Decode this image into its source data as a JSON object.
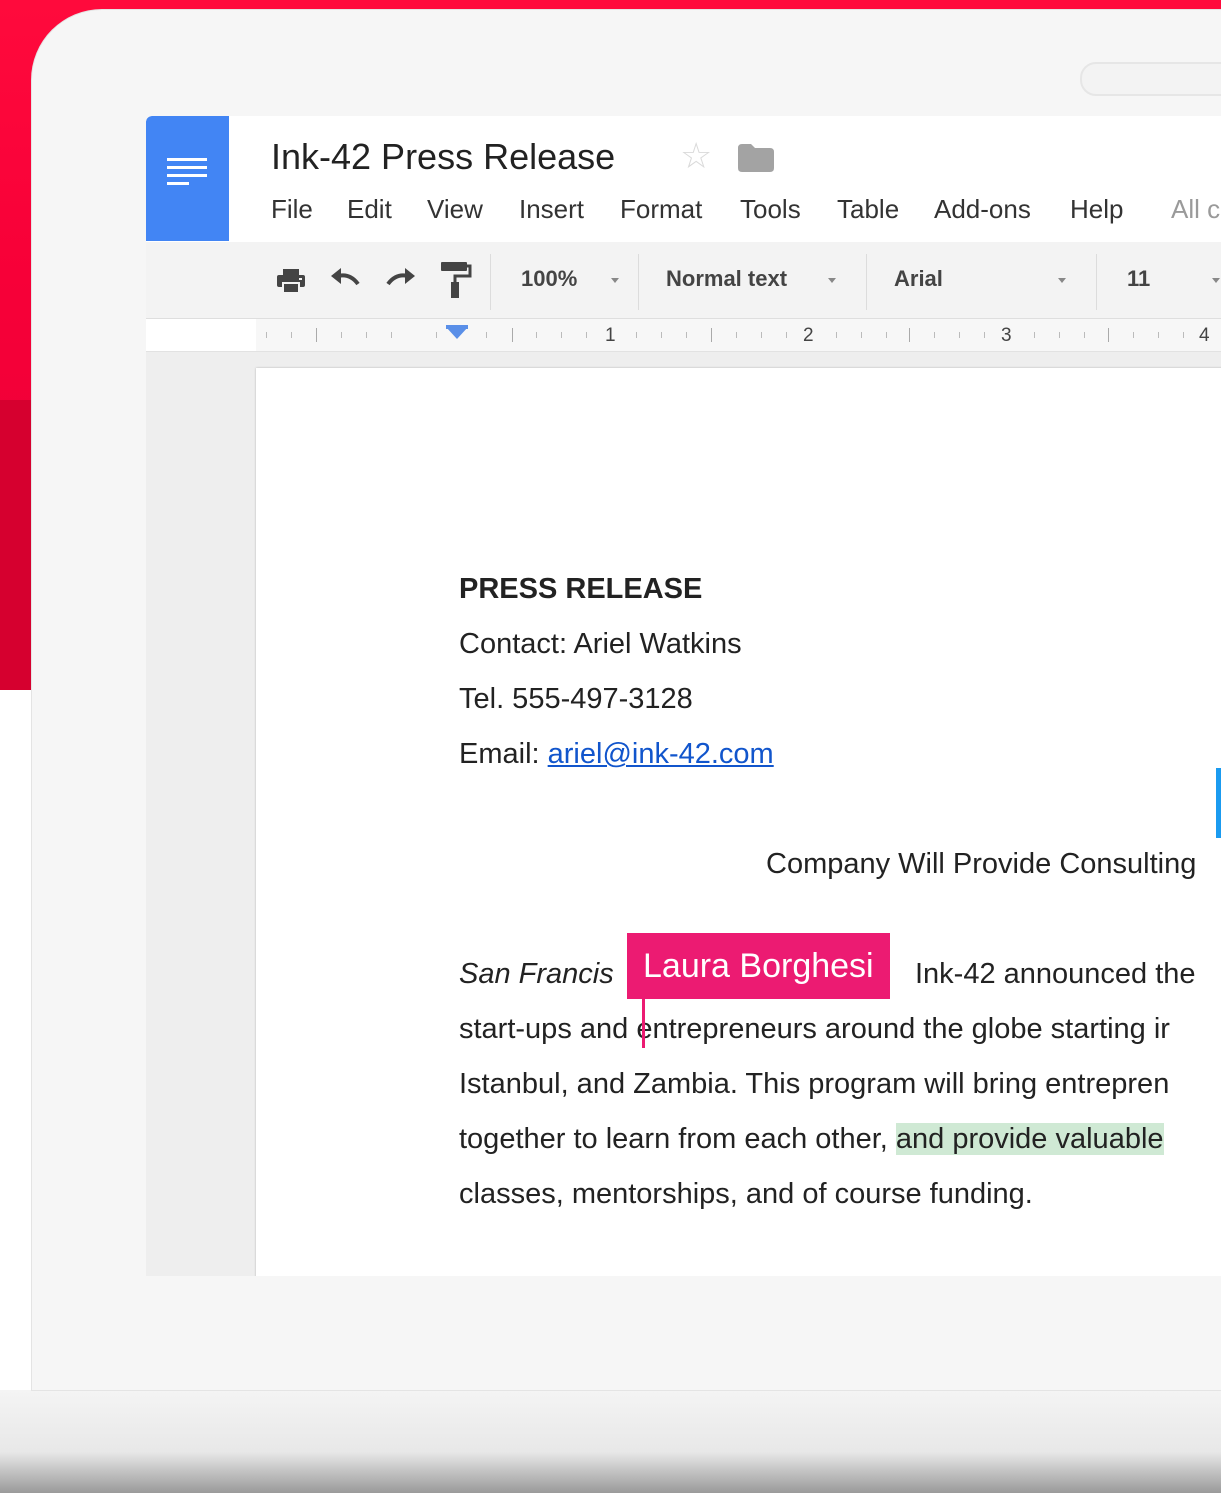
{
  "document": {
    "title": "Ink-42 Press Release"
  },
  "menu": {
    "items": [
      "File",
      "Edit",
      "View",
      "Insert",
      "Format",
      "Tools",
      "Table",
      "Add-ons",
      "Help"
    ],
    "status": "All c"
  },
  "toolbar": {
    "zoom": "100%",
    "style": "Normal text",
    "font": "Arial",
    "size": "11"
  },
  "ruler": {
    "numbers": [
      "1",
      "2",
      "3",
      "4"
    ]
  },
  "content": {
    "heading": "PRESS RELEASE",
    "contact": "Contact: Ariel Watkins",
    "tel": "Tel. 555-497-3128",
    "email_label": "Email: ",
    "email_link": "ariel@ink-42.com",
    "subtitle": "Company Will Provide Consulting",
    "p1_italic": "San Francis",
    "p1_rest": "Ink-42 announced the",
    "p2": "start-ups and entrepreneurs around the globe starting ir",
    "p3": "Istanbul, and Zambia. This program will bring entrepren",
    "p4_start": "together to learn from each other, ",
    "p4_highlight": "and provide valuable",
    "p5": "classes, mentorships, and of course funding."
  },
  "collaborator": {
    "name": "Laura Borghesi",
    "color": "#ec1b72"
  },
  "colors": {
    "brand_red": "#f70038",
    "docs_blue": "#4285f4",
    "link": "#1155cc",
    "suggestion_highlight": "#cfe9d4"
  },
  "icons": [
    "docs-logo-icon",
    "star-icon",
    "folder-icon",
    "print-icon",
    "undo-icon",
    "redo-icon",
    "paint-format-icon",
    "dropdown-caret-icon",
    "indent-marker-icon"
  ]
}
